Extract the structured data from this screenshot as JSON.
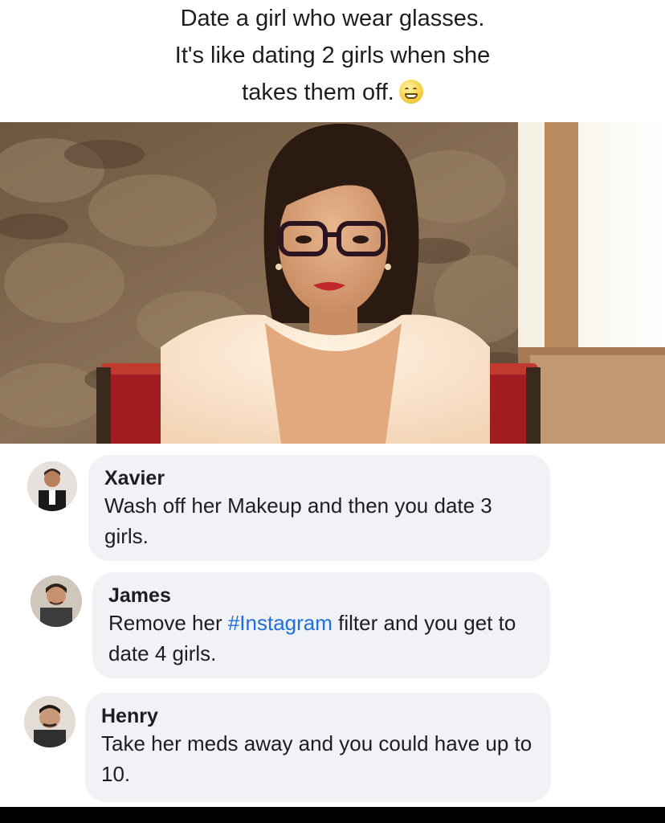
{
  "post": {
    "caption_lines": [
      "Date a girl who wear glasses.",
      "It's like dating 2 girls when she",
      "takes them off."
    ],
    "caption_emoji": "grinning-face-emoji"
  },
  "comments": [
    {
      "author": "Xavier",
      "text_before": "Wash off her Makeup and then you date 3 girls.",
      "hashtag": "",
      "text_after": ""
    },
    {
      "author": "James",
      "text_before": "Remove her ",
      "hashtag": "#Instagram",
      "text_after": " filter and you get to date 4 girls."
    },
    {
      "author": "Henry",
      "text_before": "Take her meds away and you could have up to 10.",
      "hashtag": "",
      "text_after": ""
    }
  ],
  "colors": {
    "hashtag": "#216fdb",
    "bubble": "#f0f2f5",
    "text": "#1c1e21"
  }
}
